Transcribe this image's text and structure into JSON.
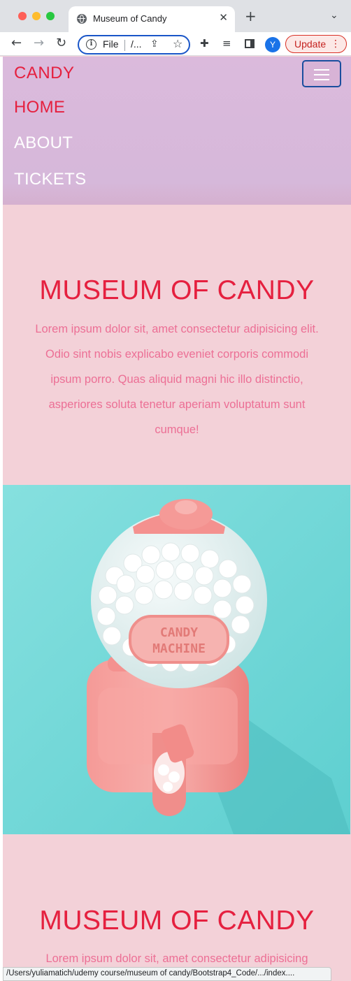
{
  "browser": {
    "tab_title": "Museum of Candy",
    "tab_close": "✕",
    "new_tab": "+",
    "tab_dropdown": "⌄",
    "back": "←",
    "forward": "→",
    "reload": "↻",
    "address_prefix": "File",
    "address_path": "/...",
    "share": "⇪",
    "star": "☆",
    "puzzle": "✚",
    "media": "≡",
    "avatar_letter": "Y",
    "update_label": "Update",
    "update_menu": "⋮",
    "status_url": "/Users/yuliamatich/udemy course/museum of candy/Bootstrap4_Code/.../index...."
  },
  "navbar": {
    "brand": "CANDY",
    "items": [
      {
        "label": "HOME"
      },
      {
        "label": "ABOUT"
      },
      {
        "label": "TICKETS"
      }
    ]
  },
  "hero": {
    "title": "MUSEUM OF CANDY",
    "text": "Lorem ipsum dolor sit, amet consectetur adipisicing elit. Odio sint nobis explicabo eveniet corporis commodi ipsum porro. Quas aliquid magni hic illo distinctio, asperiores soluta tenetur aperiam voluptatum sunt cumque!"
  },
  "image": {
    "label_line1": "CANDY",
    "label_line2": "MACHINE"
  },
  "second_section": {
    "title": "MUSEUM OF CANDY",
    "text": "Lorem ipsum dolor sit, amet consectetur adipisicing"
  },
  "colors": {
    "brand_red": "#e5203f",
    "navbar_lilac": "#dbbadc",
    "page_pink": "#f3d1d8",
    "text_pink": "#ec6f95",
    "teal": "#6fd6d6",
    "machine_pink": "#f4918f"
  }
}
